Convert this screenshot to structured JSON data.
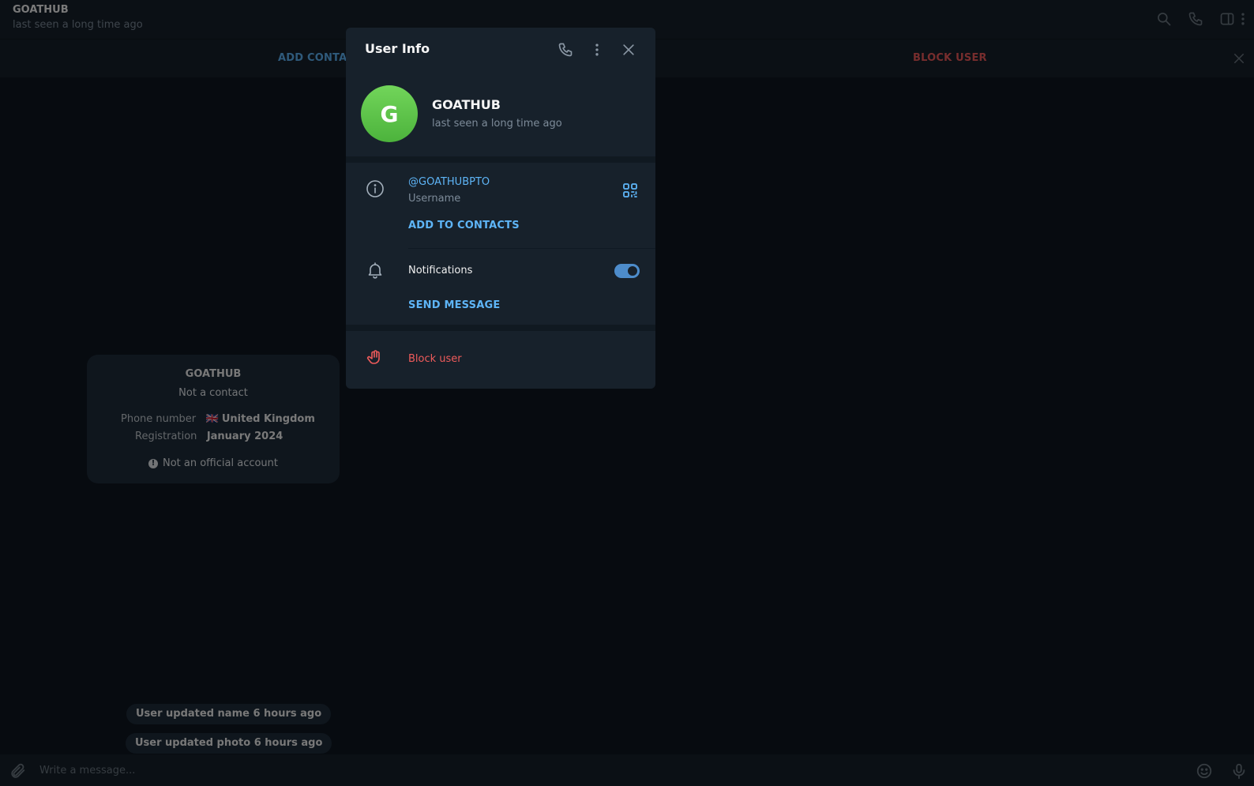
{
  "header": {
    "title": "GOATHUB",
    "status": "last seen a long time ago",
    "icons": [
      "search-icon",
      "phone-icon",
      "sidebar-toggle-icon",
      "more-vertical-icon"
    ]
  },
  "action_bar": {
    "add_contact": "ADD CONTACT",
    "block_user": "BLOCK USER"
  },
  "info_card": {
    "name": "GOATHUB",
    "subtitle": "Not a contact",
    "phone_label": "Phone number",
    "phone_flag": "🇬🇧",
    "phone_value": "United Kingdom",
    "registration_label": "Registration",
    "registration_value": "January 2024",
    "official_note": "Not an official account"
  },
  "service_messages": [
    "User updated name 6 hours ago",
    "User updated photo 6 hours ago"
  ],
  "composer": {
    "placeholder": "Write a message..."
  },
  "dialog": {
    "title": "User Info",
    "user": {
      "initial": "G",
      "name": "GOATHUB",
      "status": "last seen a long time ago",
      "avatar_color": "#5cc24a"
    },
    "username": "@GOATHUBPTO",
    "username_label": "Username",
    "add_to_contacts": "ADD TO CONTACTS",
    "notifications_label": "Notifications",
    "notifications_on": true,
    "send_message": "SEND MESSAGE",
    "block_user": "Block user"
  },
  "colors": {
    "accent": "#5eb5f7",
    "danger": "#ef5b5b",
    "panel": "#17212b",
    "background": "#0e1621"
  }
}
